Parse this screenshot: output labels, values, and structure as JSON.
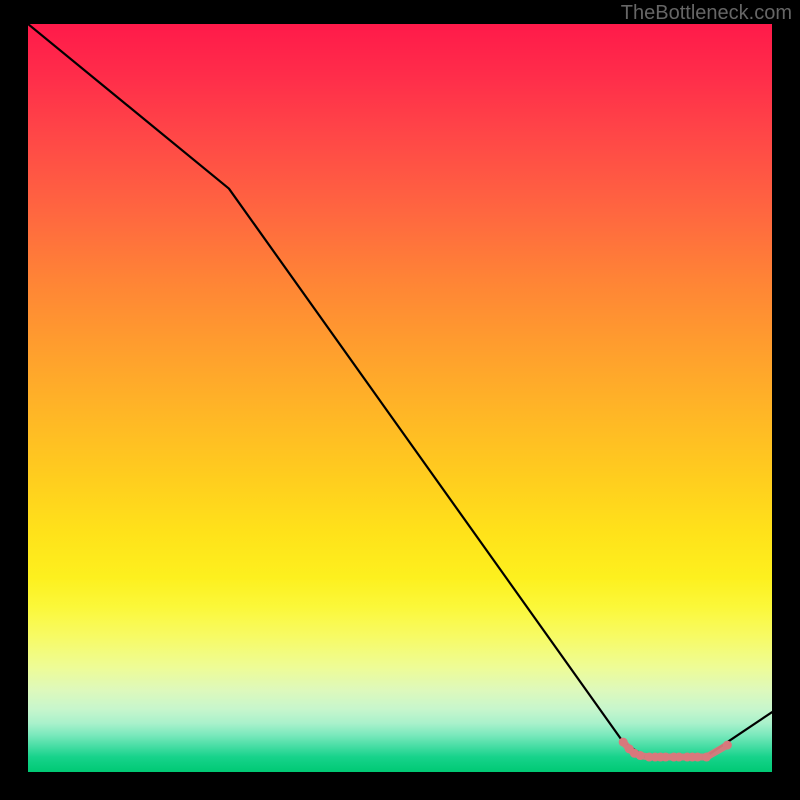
{
  "watermark": "TheBottleneck.com",
  "chart_data": {
    "type": "line",
    "title": "",
    "xlabel": "",
    "ylabel": "",
    "xlim": [
      0,
      100
    ],
    "ylim": [
      0,
      100
    ],
    "series": [
      {
        "name": "bottleneck-curve",
        "x": [
          0,
          27,
          80,
          83,
          91,
          100
        ],
        "y": [
          100,
          78,
          4,
          2,
          2,
          8
        ],
        "color": "#000000"
      }
    ],
    "markers": {
      "name": "optimal-range",
      "color": "#d9787c",
      "points": [
        {
          "x": 80.0,
          "y": 4.0
        },
        {
          "x": 80.8,
          "y": 3.1
        },
        {
          "x": 81.5,
          "y": 2.5
        },
        {
          "x": 82.3,
          "y": 2.2
        },
        {
          "x": 83.5,
          "y": 2.0
        },
        {
          "x": 84.3,
          "y": 2.0
        },
        {
          "x": 85.0,
          "y": 2.0
        },
        {
          "x": 85.7,
          "y": 2.0
        },
        {
          "x": 86.8,
          "y": 2.0
        },
        {
          "x": 87.5,
          "y": 2.0
        },
        {
          "x": 88.6,
          "y": 2.0
        },
        {
          "x": 89.3,
          "y": 2.0
        },
        {
          "x": 90.0,
          "y": 2.0
        },
        {
          "x": 91.2,
          "y": 2.0
        },
        {
          "x": 94.0,
          "y": 3.6
        }
      ]
    },
    "gradient_stops": [
      {
        "pos": 0,
        "color": "#ff1a4a"
      },
      {
        "pos": 50,
        "color": "#ffc722"
      },
      {
        "pos": 80,
        "color": "#f7fb66"
      },
      {
        "pos": 100,
        "color": "#00c974"
      }
    ]
  }
}
